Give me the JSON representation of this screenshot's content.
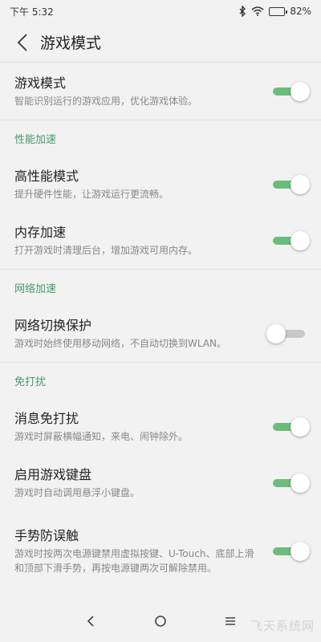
{
  "status": {
    "time": "下午 5:32",
    "battery": "82%",
    "battery_level": 0.82,
    "icons": [
      "bluetooth-icon",
      "wifi-icon",
      "battery-icon"
    ]
  },
  "header": {
    "title": "游戏模式",
    "back_icon": "back-arrow-icon"
  },
  "main_setting": {
    "title": "游戏模式",
    "desc": "智能识别运行的游戏应用，优化游戏体验。",
    "enabled": true
  },
  "sections": [
    {
      "header": "性能加速",
      "items": [
        {
          "title": "高性能模式",
          "desc": "提升硬件性能，让游戏运行更流畅。",
          "enabled": true
        },
        {
          "title": "内存加速",
          "desc": "打开游戏时清理后台，增加游戏可用内存。",
          "enabled": true
        }
      ]
    },
    {
      "header": "网络加速",
      "items": [
        {
          "title": "网络切换保护",
          "desc": "游戏时始终使用移动网络，不自动切换到WLAN。",
          "enabled": false
        }
      ]
    },
    {
      "header": "免打扰",
      "items": [
        {
          "title": "消息免打扰",
          "desc": "游戏时屏蔽横幅通知，来电、闹钟除外。",
          "enabled": true
        },
        {
          "title": "启用游戏键盘",
          "desc": "游戏时自动调用悬浮小键盘。",
          "enabled": true
        },
        {
          "title": "手势防误触",
          "desc": "游戏时按两次电源键禁用虚拟按键、U-Touch、底部上滑和顶部下滑手势，再按电源键两次可解除禁用。",
          "enabled": true
        }
      ]
    }
  ],
  "nav": {
    "icons": [
      "back-icon",
      "home-icon",
      "menu-icon"
    ]
  },
  "watermark": "飞天系统网",
  "colors": {
    "accent": "#4a9a6a",
    "toggle_on": "#6cbd7d",
    "toggle_off": "#c8c8c8",
    "background": "#f2f2f2"
  }
}
